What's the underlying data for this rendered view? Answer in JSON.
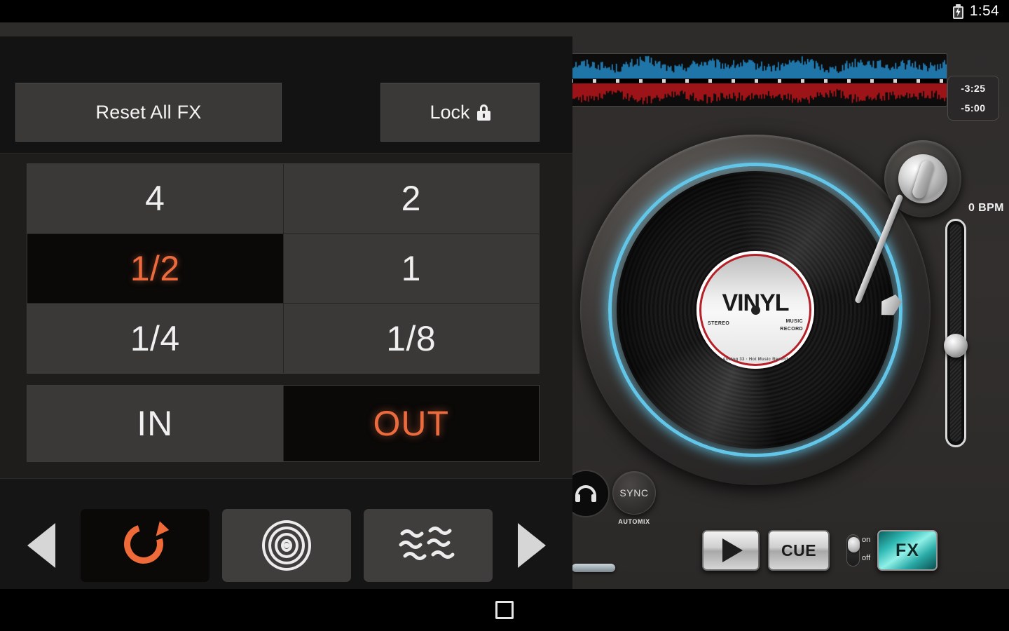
{
  "status_bar": {
    "battery_icon": "battery-charging-icon",
    "clock": "1:54"
  },
  "deck": {
    "waveform": {
      "top_color": "#1f74a8",
      "bottom_color": "#9d1418",
      "beat_marker_color": "#d8d8d8"
    },
    "time_readout": {
      "elapsed_remaining": "-3:25",
      "total_remaining": "-5:00"
    },
    "turntable": {
      "glow_color": "#63c6e8",
      "record_label_title": "VINYL",
      "record_label_left": "STEREO",
      "record_label_right": "MUSIC\nRECORD",
      "record_label_footer": "Analog 33 · Hot Music Record",
      "tonearm_icon": "tonearm-icon"
    },
    "bpm": "0 BPM",
    "pitch_fader": {
      "name": "pitch-fader",
      "knob_position_percent": 55
    },
    "cue_phones_icon": "headphones-icon",
    "sync": {
      "label": "SYNC",
      "sub_label": "AUTOMIX"
    },
    "transport": {
      "play_icon": "play-icon",
      "cue_label": "CUE",
      "toggle_on_label": "on",
      "toggle_off_label": "off",
      "fx_label": "FX",
      "fx_accent_color": "#2fb9b4"
    }
  },
  "fx_panel": {
    "accent_color": "#ec6b3e",
    "reset_label": "Reset All FX",
    "lock_label": "Lock",
    "lock_icon": "padlock-closed-icon",
    "beat_grid": [
      {
        "label": "4",
        "active": false
      },
      {
        "label": "2",
        "active": false
      },
      {
        "label": "1/2",
        "active": true
      },
      {
        "label": "1",
        "active": false
      },
      {
        "label": "1/4",
        "active": false
      },
      {
        "label": "1/8",
        "active": false
      }
    ],
    "inout": [
      {
        "label": "IN",
        "active": false
      },
      {
        "label": "OUT",
        "active": true
      }
    ],
    "fx_slots": [
      {
        "icon": "loop-repeat-icon",
        "active": true
      },
      {
        "icon": "concentric-echo-icon",
        "active": false
      },
      {
        "icon": "wave-flanger-icon",
        "active": false
      }
    ],
    "prev_arrow_icon": "chevron-left-icon",
    "next_arrow_icon": "chevron-right-icon"
  },
  "nav_bar": {
    "home_icon": "square-home-icon"
  }
}
